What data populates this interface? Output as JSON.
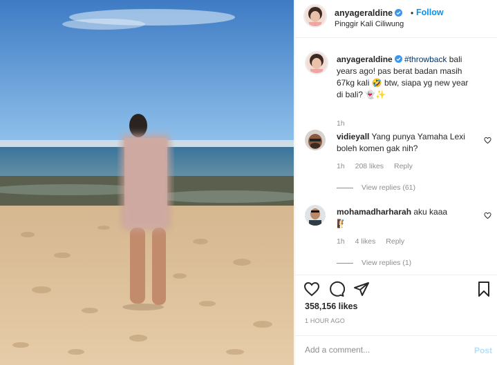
{
  "post": {
    "photo_alt": "beach photo"
  },
  "header": {
    "username": "anyageraldine",
    "dot": "•",
    "follow_label": "Follow",
    "location": "Pinggir Kali Ciliwung"
  },
  "caption": {
    "username": "anyageraldine",
    "hashtag": "#throwback",
    "text": " bali years ago! pas berat badan masih 67kg kali 🤣 btw, siapa yg new year di bali? 👻✨",
    "time": "1h"
  },
  "comments": [
    {
      "username": "vidieyall",
      "text": "Yang punya Yamaha Lexi boleh komen gak nih?",
      "time": "1h",
      "likes": "208 likes",
      "reply_label": "Reply",
      "view_replies": "View replies (61)"
    },
    {
      "username": "mohamadharharah",
      "text": "aku kaaa",
      "emoji": "🧗",
      "time": "1h",
      "likes": "4 likes",
      "reply_label": "Reply",
      "view_replies": "View replies (1)"
    }
  ],
  "actions": {
    "icons": [
      "heart-icon",
      "comment-icon",
      "share-icon",
      "bookmark-icon"
    ]
  },
  "likes_count": "358,156 likes",
  "timestamp": "1 HOUR AGO",
  "add_comment": {
    "placeholder": "Add a comment...",
    "post_label": "Post"
  },
  "colors": {
    "accent": "#0095f6",
    "post_disabled": "#b2dffc",
    "muted": "#8e8e8e",
    "text": "#262626"
  }
}
